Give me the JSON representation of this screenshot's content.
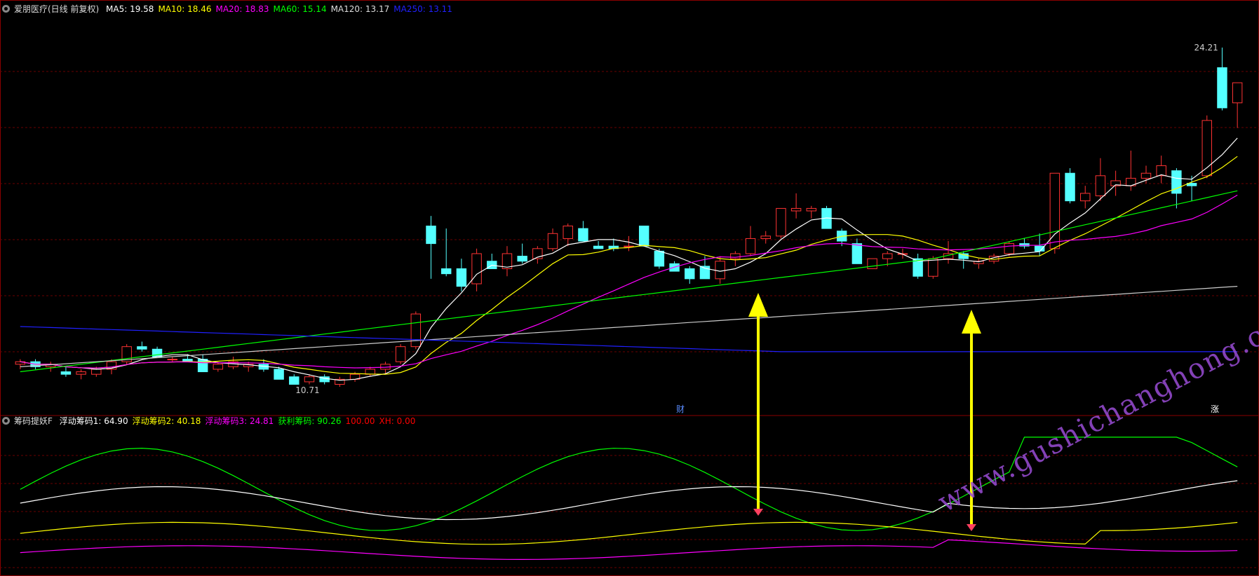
{
  "main_panel": {
    "title": "爱朋医疗(日线 前复权)",
    "indicators": [
      {
        "label": "MA5: 19.58",
        "color": "#ffffff"
      },
      {
        "label": "MA10: 18.46",
        "color": "#ffff00"
      },
      {
        "label": "MA20: 18.83",
        "color": "#ff00ff"
      },
      {
        "label": "MA60: 15.14",
        "color": "#00ff00"
      },
      {
        "label": "MA120: 13.17",
        "color": "#dddddd"
      },
      {
        "label": "MA250: 13.11",
        "color": "#2020ff"
      }
    ],
    "high_label": "24.21",
    "low_label": "10.71",
    "finance_marker": "财"
  },
  "sub_panel": {
    "title": "筹码提妖F",
    "indicators": [
      {
        "label": "浮动筹码1: 64.90",
        "color": "#ffffff"
      },
      {
        "label": "浮动筹码2: 40.18",
        "color": "#ffff00"
      },
      {
        "label": "浮动筹码3: 24.81",
        "color": "#ff00ff"
      },
      {
        "label": "获利筹码: 90.26",
        "color": "#00ff00"
      },
      {
        "label": "100.00",
        "color": "#ff0000"
      },
      {
        "label": "XH: 0.00",
        "color": "#ff0000"
      }
    ],
    "zhang_marker": "涨"
  },
  "watermark": "www.gushichanghong.com",
  "colors": {
    "up": "#ff3333",
    "down": "#54ffff",
    "grid": "#6a0000",
    "arrow": "#ffff00"
  },
  "chart_data": {
    "type": "candlestick",
    "price_range": [
      10.0,
      25.0
    ],
    "candles": [
      [
        11.4,
        11.6,
        11.2,
        11.5
      ],
      [
        11.5,
        11.6,
        11.2,
        11.3
      ],
      [
        11.3,
        11.5,
        11.1,
        11.4
      ],
      [
        11.1,
        11.3,
        10.9,
        11.0
      ],
      [
        11.0,
        11.2,
        10.8,
        11.1
      ],
      [
        11.0,
        11.3,
        10.9,
        11.2
      ],
      [
        11.2,
        11.6,
        11.0,
        11.5
      ],
      [
        11.5,
        12.2,
        11.4,
        12.1
      ],
      [
        12.1,
        12.3,
        11.9,
        12.0
      ],
      [
        12.0,
        12.1,
        11.8,
        11.7
      ],
      [
        11.6,
        11.7,
        11.5,
        11.6
      ],
      [
        11.6,
        11.8,
        11.5,
        11.5
      ],
      [
        11.6,
        11.8,
        11.2,
        11.1
      ],
      [
        11.2,
        11.5,
        11.1,
        11.4
      ],
      [
        11.3,
        11.7,
        11.2,
        11.5
      ],
      [
        11.3,
        11.5,
        11.1,
        11.4
      ],
      [
        11.4,
        11.6,
        11.1,
        11.2
      ],
      [
        11.2,
        11.3,
        10.8,
        10.8
      ],
      [
        10.9,
        11.0,
        10.7,
        10.6
      ],
      [
        10.7,
        11.0,
        10.6,
        10.9
      ],
      [
        10.9,
        11.0,
        10.6,
        10.7
      ],
      [
        10.6,
        10.9,
        10.5,
        10.8
      ],
      [
        10.8,
        11.1,
        10.7,
        11.0
      ],
      [
        11.0,
        11.3,
        10.9,
        11.2
      ],
      [
        11.2,
        11.5,
        11.0,
        11.4
      ],
      [
        11.5,
        12.2,
        11.4,
        12.1
      ],
      [
        12.1,
        13.5,
        12.0,
        13.4
      ],
      [
        16.9,
        17.3,
        14.8,
        16.2
      ],
      [
        15.2,
        16.8,
        14.9,
        15.0
      ],
      [
        15.2,
        15.6,
        14.3,
        14.5
      ],
      [
        14.6,
        16.0,
        14.3,
        15.8
      ],
      [
        15.5,
        15.8,
        15.2,
        15.2
      ],
      [
        15.2,
        16.1,
        14.9,
        15.8
      ],
      [
        15.7,
        16.2,
        15.4,
        15.5
      ],
      [
        15.6,
        16.1,
        15.4,
        16.0
      ],
      [
        16.0,
        16.8,
        15.9,
        16.6
      ],
      [
        16.4,
        17.0,
        16.1,
        16.9
      ],
      [
        16.8,
        17.1,
        16.3,
        16.3
      ],
      [
        16.1,
        16.3,
        16.0,
        16.0
      ],
      [
        16.1,
        16.4,
        15.9,
        16.0
      ],
      [
        16.1,
        16.5,
        15.9,
        16.1
      ],
      [
        16.9,
        16.9,
        16.1,
        16.1
      ],
      [
        15.9,
        16.0,
        15.2,
        15.3
      ],
      [
        15.4,
        15.5,
        15.2,
        15.1
      ],
      [
        15.2,
        15.3,
        14.6,
        14.8
      ],
      [
        15.3,
        15.7,
        14.8,
        14.8
      ],
      [
        14.8,
        15.7,
        14.6,
        15.5
      ],
      [
        15.6,
        15.9,
        15.3,
        15.8
      ],
      [
        15.8,
        16.9,
        15.7,
        16.4
      ],
      [
        16.4,
        16.7,
        16.2,
        16.5
      ],
      [
        16.5,
        17.6,
        16.4,
        17.6
      ],
      [
        17.5,
        18.2,
        17.2,
        17.6
      ],
      [
        17.5,
        17.7,
        17.2,
        17.6
      ],
      [
        17.6,
        17.7,
        17.0,
        16.8
      ],
      [
        16.7,
        16.8,
        16.1,
        16.3
      ],
      [
        16.2,
        16.4,
        15.8,
        15.4
      ],
      [
        15.2,
        15.5,
        15.2,
        15.6
      ],
      [
        15.6,
        15.9,
        15.3,
        15.8
      ],
      [
        15.8,
        16.0,
        15.6,
        15.8
      ],
      [
        15.6,
        15.8,
        14.8,
        14.9
      ],
      [
        14.9,
        15.7,
        14.8,
        15.6
      ],
      [
        15.6,
        16.3,
        15.4,
        15.8
      ],
      [
        15.8,
        15.9,
        15.2,
        15.6
      ],
      [
        15.4,
        15.6,
        15.2,
        15.5
      ],
      [
        15.5,
        15.8,
        15.4,
        15.7
      ],
      [
        15.8,
        16.3,
        15.7,
        16.2
      ],
      [
        16.2,
        16.4,
        16.0,
        16.1
      ],
      [
        16.1,
        16.6,
        15.7,
        15.9
      ],
      [
        16.0,
        19.0,
        15.8,
        19.0
      ],
      [
        19.0,
        19.2,
        17.8,
        17.9
      ],
      [
        17.9,
        18.5,
        17.6,
        18.2
      ],
      [
        18.1,
        19.6,
        17.9,
        18.9
      ],
      [
        18.5,
        19.1,
        18.1,
        18.7
      ],
      [
        18.5,
        19.9,
        18.3,
        18.8
      ],
      [
        18.8,
        19.3,
        18.6,
        19.0
      ],
      [
        18.9,
        19.7,
        18.6,
        19.3
      ],
      [
        19.1,
        19.2,
        17.6,
        18.2
      ],
      [
        18.6,
        18.9,
        17.9,
        18.5
      ],
      [
        18.9,
        21.3,
        18.8,
        21.1
      ],
      [
        23.2,
        24.0,
        21.5,
        21.6
      ],
      [
        21.8,
        22.2,
        20.8,
        22.6
      ]
    ],
    "sub_series_names": [
      "浮动筹码1",
      "浮动筹码2",
      "浮动筹码3",
      "获利筹码"
    ],
    "sub_range": [
      0,
      100
    ]
  }
}
